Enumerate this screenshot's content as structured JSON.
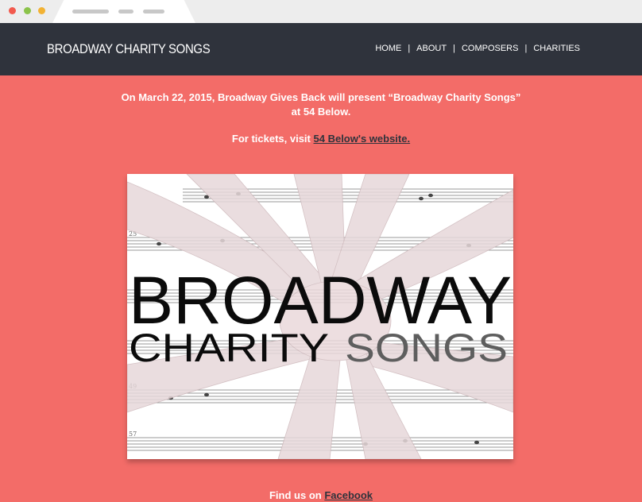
{
  "browser": {
    "buttons": [
      "close",
      "minimize",
      "maximize"
    ]
  },
  "header": {
    "brand": "BROADWAY CHARITY SONGS",
    "nav": [
      "HOME",
      "ABOUT",
      "COMPOSERS",
      "CHARITIES"
    ],
    "separator": "|"
  },
  "content": {
    "intro_line1": "On March 22, 2015, Broadway Gives Back will present “Broadway Charity Songs”",
    "intro_line2": "at 54 Below.",
    "tickets_prefix": "For tickets, visit",
    "tickets_link": "54 Below's website."
  },
  "poster": {
    "title_line1": "BROADWAY",
    "title_word1": "CHARITY",
    "title_word2": "SONGS",
    "measure_numbers": [
      "25",
      "49",
      "57"
    ]
  },
  "footer": {
    "prefix": "Find us on",
    "link": "Facebook"
  },
  "colors": {
    "navbar": "#2f333c",
    "background": "#f36c68",
    "link": "#2f333c"
  }
}
